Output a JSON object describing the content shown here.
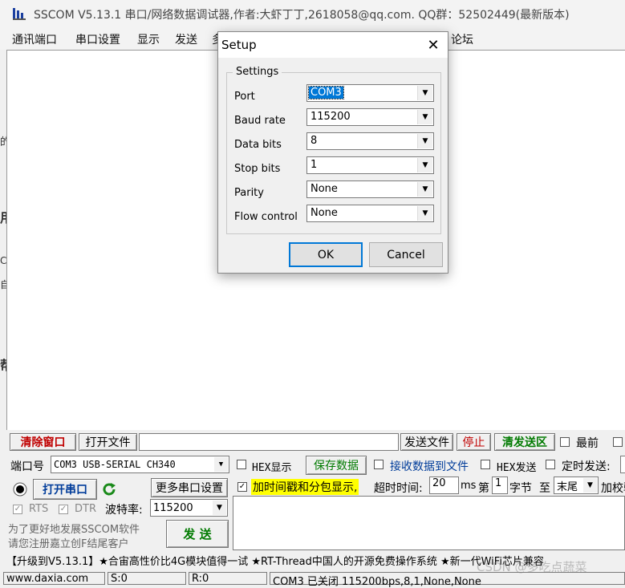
{
  "window": {
    "title": "SSCOM V5.13.1 串口/网络数据调试器,作者:大虾丁丁,2618058@qq.com. QQ群：52502449(最新版本)"
  },
  "menu": {
    "items": [
      "通讯端口",
      "串口设置",
      "显示",
      "发送",
      "多",
      "论坛"
    ]
  },
  "left_edge": [
    "的",
    "用",
    "C",
    "自",
    "帮"
  ],
  "bottom": {
    "clear_window": "清除窗口",
    "open_file": "打开文件",
    "send_file": "发送文件",
    "stop": "停止",
    "clear_send": "清发送区",
    "front_label": "最前",
    "port_label": "端口号",
    "port_value": "COM3 USB-SERIAL CH340",
    "hex_display": "HEX显示",
    "save_data": "保存数据",
    "recv_to_file": "接收数据到文件",
    "hex_send": "HEX发送",
    "timed_send": "定时发送:",
    "open_port": "打开串口",
    "more_settings": "更多串口设置",
    "timestamp": "加时间戳和分包显示,",
    "timeout_label": "超时时间:",
    "timeout_value": "20",
    "ms": "ms",
    "nth_label": "第",
    "nth_value": "1",
    "byte_label": "字节",
    "to_label": "至",
    "end_value": "末尾",
    "checksum": "加校验",
    "rts": "RTS",
    "dtr": "DTR",
    "baud_label": "波特率:",
    "baud_value": "115200",
    "promo_line1": "为了更好地发展SSCOM软件",
    "promo_line2": "请您注册嘉立创F结尾客户",
    "send": "发  送",
    "ticker": "【升级到V5.13.1】★合宙高性价比4G模块值得一试 ★RT-Thread中国人的开源免费操作系统 ★新一代WiFi芯片兼容",
    "status_site": "www.daxia.com",
    "status_s": "S:0",
    "status_r": "R:0",
    "status_port": "COM3 已关闭  115200bps,8,1,None,None"
  },
  "watermark": "CSDN @多吃点蔬菜",
  "dialog": {
    "title": "Setup",
    "group": "Settings",
    "fields": [
      {
        "label": "Port",
        "value": "COM3"
      },
      {
        "label": "Baud rate",
        "value": "115200"
      },
      {
        "label": "Data bits",
        "value": "8"
      },
      {
        "label": "Stop bits",
        "value": "1"
      },
      {
        "label": "Parity",
        "value": "None"
      },
      {
        "label": "Flow control",
        "value": "None"
      }
    ],
    "ok": "OK",
    "cancel": "Cancel"
  },
  "colors": {
    "accent_red": "#c00000",
    "accent_green": "#007a00",
    "highlight_yellow": "#ffff00",
    "selection_blue": "#0078d7"
  }
}
